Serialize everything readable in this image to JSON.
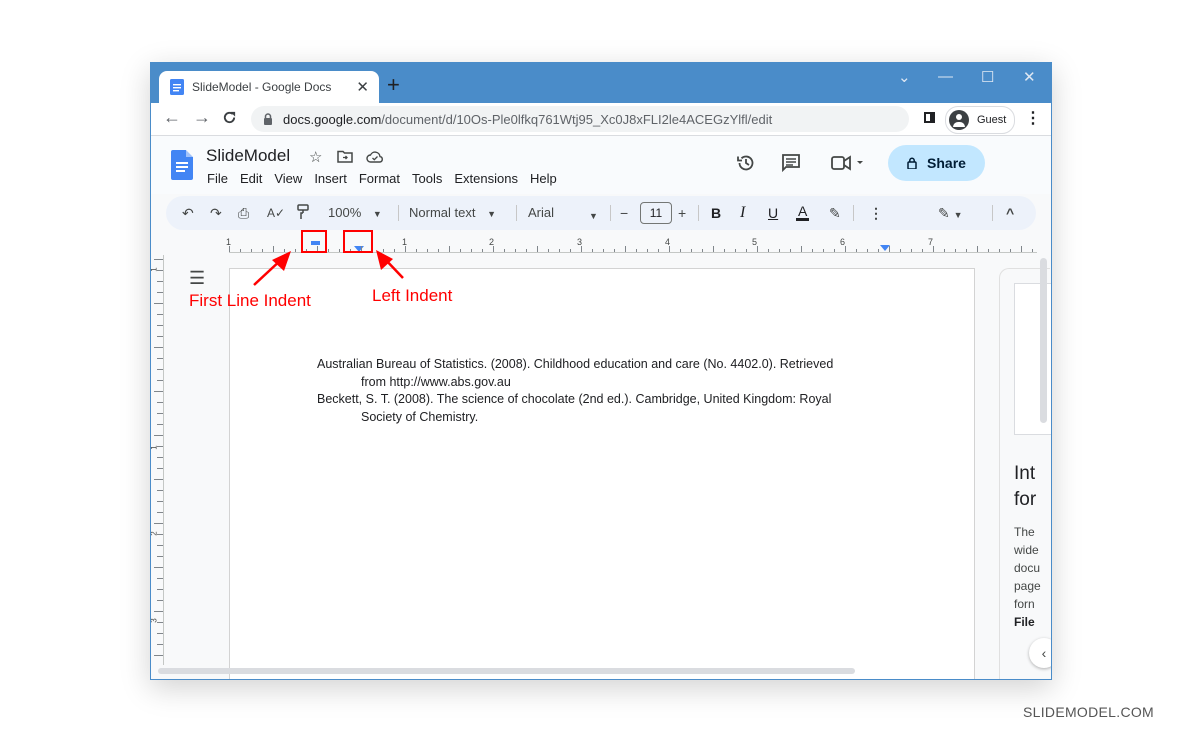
{
  "browser": {
    "tab_title": "SlideModel - Google Docs",
    "tab_close": "✕",
    "new_tab": "+",
    "window_controls": {
      "dropdown": "⌄",
      "minimize": "—",
      "maximize": "☐",
      "close": "✕"
    },
    "nav": {
      "back": "←",
      "forward": "→",
      "reload": "C"
    },
    "url_host": "docs.google.com",
    "url_path": "/document/d/10Os-Ple0lfkq761Wtj95_Xc0J8xFLI2le4ACEGzYlfl/edit",
    "profile_label": "Guest",
    "menu": "⋮"
  },
  "docs": {
    "title": "SlideModel",
    "title_icons": [
      "star-icon",
      "move-to-folder-icon",
      "cloud-saved-icon"
    ],
    "menu": [
      "File",
      "Edit",
      "View",
      "Insert",
      "Format",
      "Tools",
      "Extensions",
      "Help"
    ],
    "header_icons": [
      "version-history-icon",
      "comments-icon",
      "meet-icon"
    ],
    "share_label": "Share",
    "brand_color": "#4285f4",
    "share_bg": "#c2e7ff"
  },
  "toolbar": {
    "undo": "↶",
    "redo": "↷",
    "print": "⎙",
    "spellcheck": "A✓",
    "paint_format": "🖌",
    "zoom": "100%",
    "style": "Normal text",
    "font": "Arial",
    "font_size": "11",
    "minus": "−",
    "plus": "+",
    "bold": "B",
    "italic": "I",
    "underline": "U",
    "text_color": "A",
    "highlight": "✎",
    "more": "⋮",
    "editing_mode": "✎",
    "collapse": "^"
  },
  "ruler": {
    "numbers": [
      "1",
      "1",
      "2",
      "3",
      "4",
      "5",
      "6",
      "7"
    ],
    "vertical_numbers": [
      "1",
      "1",
      "2",
      "3"
    ]
  },
  "document": {
    "paragraphs": [
      {
        "first_line": "Australian Bureau of Statistics. (2008). Childhood education and care (No. 4402.0). Retrieved",
        "continuation": "from http://www.abs.gov.au"
      },
      {
        "first_line": "Beckett, S. T. (2008). The science of chocolate (2nd ed.). Cambridge, United Kingdom: Royal",
        "continuation": "Society of Chemistry."
      }
    ]
  },
  "side_panel": {
    "heading": "Int\nfor",
    "body_lines": [
      "The",
      "wide",
      "docu",
      "page",
      "forn"
    ],
    "body_bold": "File"
  },
  "annotations": {
    "first_line_indent": "First Line Indent",
    "left_indent": "Left Indent",
    "color": "#ff0000"
  },
  "watermark": "SLIDEMODEL.COM"
}
